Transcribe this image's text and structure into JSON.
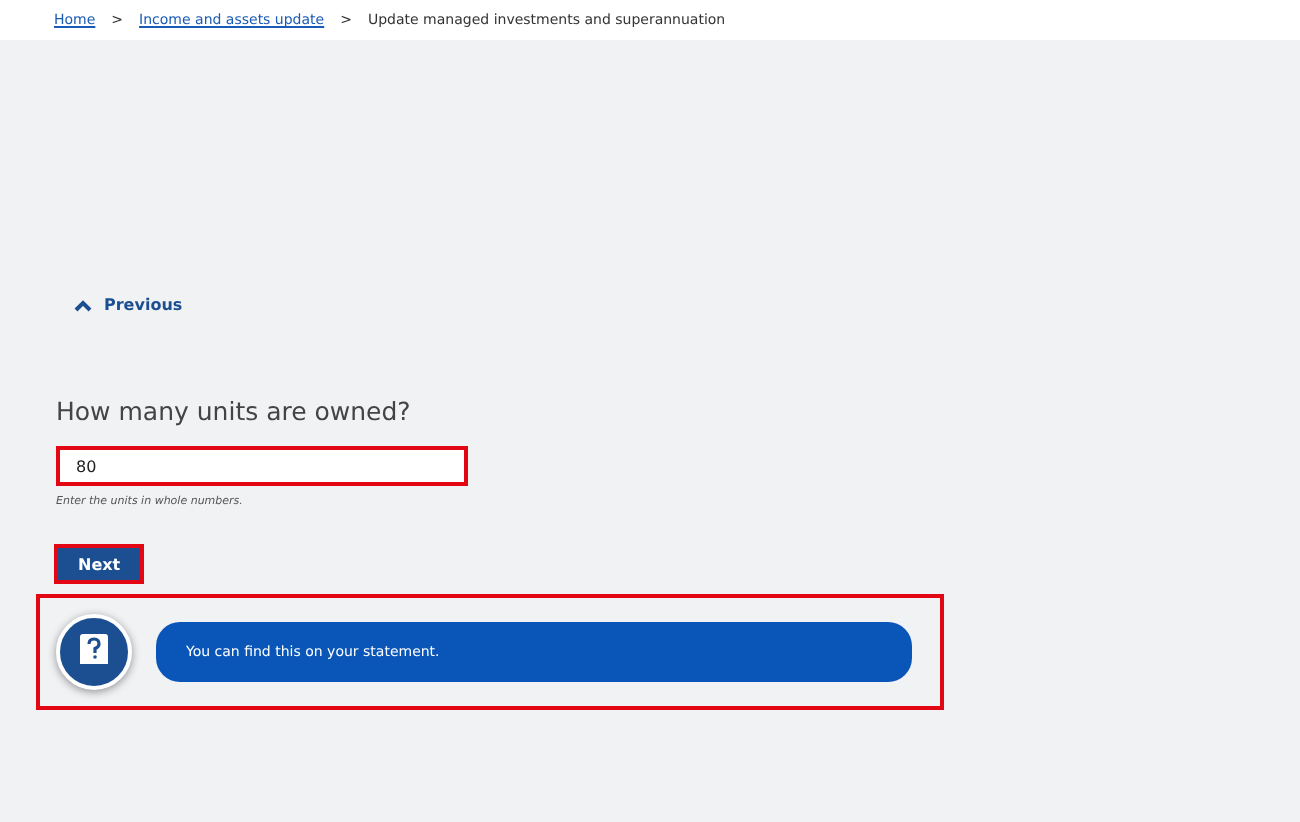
{
  "breadcrumb": [
    {
      "label": "Home",
      "link": true
    },
    {
      "label": "Income and assets update",
      "link": true
    },
    {
      "label": "Update managed investments and superannuation",
      "link": false
    }
  ],
  "breadcrumb_separator": ">",
  "previous": {
    "label": "Previous"
  },
  "question": {
    "label": "How many units are owned?",
    "value": "80",
    "hint": "Enter the units in whole numbers.",
    "highlighted": true
  },
  "next_button": {
    "label": "Next",
    "highlighted": true
  },
  "help": {
    "text": "You can find this on your statement.",
    "highlighted": true
  }
}
